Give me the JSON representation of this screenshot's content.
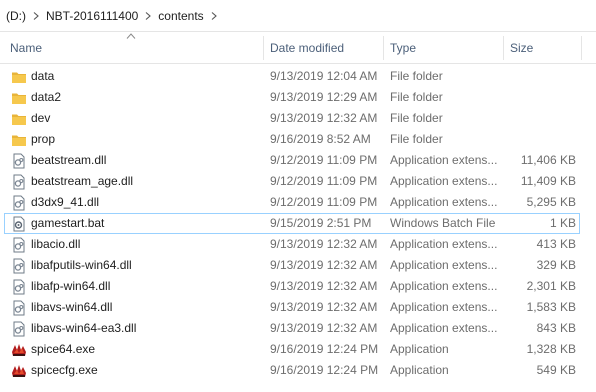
{
  "breadcrumb": {
    "items": [
      {
        "label": "(D:)"
      },
      {
        "label": "NBT-2016111400"
      },
      {
        "label": "contents"
      }
    ]
  },
  "columns": {
    "name": "Name",
    "date": "Date modified",
    "type": "Type",
    "size": "Size",
    "sort": "ascending"
  },
  "colors": {
    "selection_border": "#99d1ff",
    "header_text": "#4c607a",
    "secondary_text": "#6d6d6d",
    "folder": "#f6c84d"
  },
  "files": [
    {
      "name": "data",
      "date": "9/13/2019 12:04 AM",
      "type": "File folder",
      "size": "",
      "icon": "folder-icon"
    },
    {
      "name": "data2",
      "date": "9/13/2019 12:29 AM",
      "type": "File folder",
      "size": "",
      "icon": "folder-icon"
    },
    {
      "name": "dev",
      "date": "9/13/2019 12:32 AM",
      "type": "File folder",
      "size": "",
      "icon": "folder-icon"
    },
    {
      "name": "prop",
      "date": "9/16/2019 8:52 AM",
      "type": "File folder",
      "size": "",
      "icon": "folder-icon"
    },
    {
      "name": "beatstream.dll",
      "date": "9/12/2019 11:09 PM",
      "type": "Application extens...",
      "size": "11,406 KB",
      "icon": "dll-file-icon"
    },
    {
      "name": "beatstream_age.dll",
      "date": "9/12/2019 11:09 PM",
      "type": "Application extens...",
      "size": "11,409 KB",
      "icon": "dll-file-icon"
    },
    {
      "name": "d3dx9_41.dll",
      "date": "9/12/2019 11:09 PM",
      "type": "Application extens...",
      "size": "5,295 KB",
      "icon": "dll-file-icon"
    },
    {
      "name": "gamestart.bat",
      "date": "9/15/2019 2:51 PM",
      "type": "Windows Batch File",
      "size": "1 KB",
      "icon": "batch-file-icon",
      "selected": true
    },
    {
      "name": "libacio.dll",
      "date": "9/13/2019 12:32 AM",
      "type": "Application extens...",
      "size": "413 KB",
      "icon": "dll-file-icon"
    },
    {
      "name": "libafputils-win64.dll",
      "date": "9/13/2019 12:32 AM",
      "type": "Application extens...",
      "size": "329 KB",
      "icon": "dll-file-icon"
    },
    {
      "name": "libafp-win64.dll",
      "date": "9/13/2019 12:32 AM",
      "type": "Application extens...",
      "size": "2,301 KB",
      "icon": "dll-file-icon"
    },
    {
      "name": "libavs-win64.dll",
      "date": "9/13/2019 12:32 AM",
      "type": "Application extens...",
      "size": "1,583 KB",
      "icon": "dll-file-icon"
    },
    {
      "name": "libavs-win64-ea3.dll",
      "date": "9/13/2019 12:32 AM",
      "type": "Application extens...",
      "size": "843 KB",
      "icon": "dll-file-icon"
    },
    {
      "name": "spice64.exe",
      "date": "9/16/2019 12:24 PM",
      "type": "Application",
      "size": "1,328 KB",
      "icon": "spice-app-icon"
    },
    {
      "name": "spicecfg.exe",
      "date": "9/16/2019 12:24 PM",
      "type": "Application",
      "size": "549 KB",
      "icon": "spice-app-icon"
    }
  ]
}
